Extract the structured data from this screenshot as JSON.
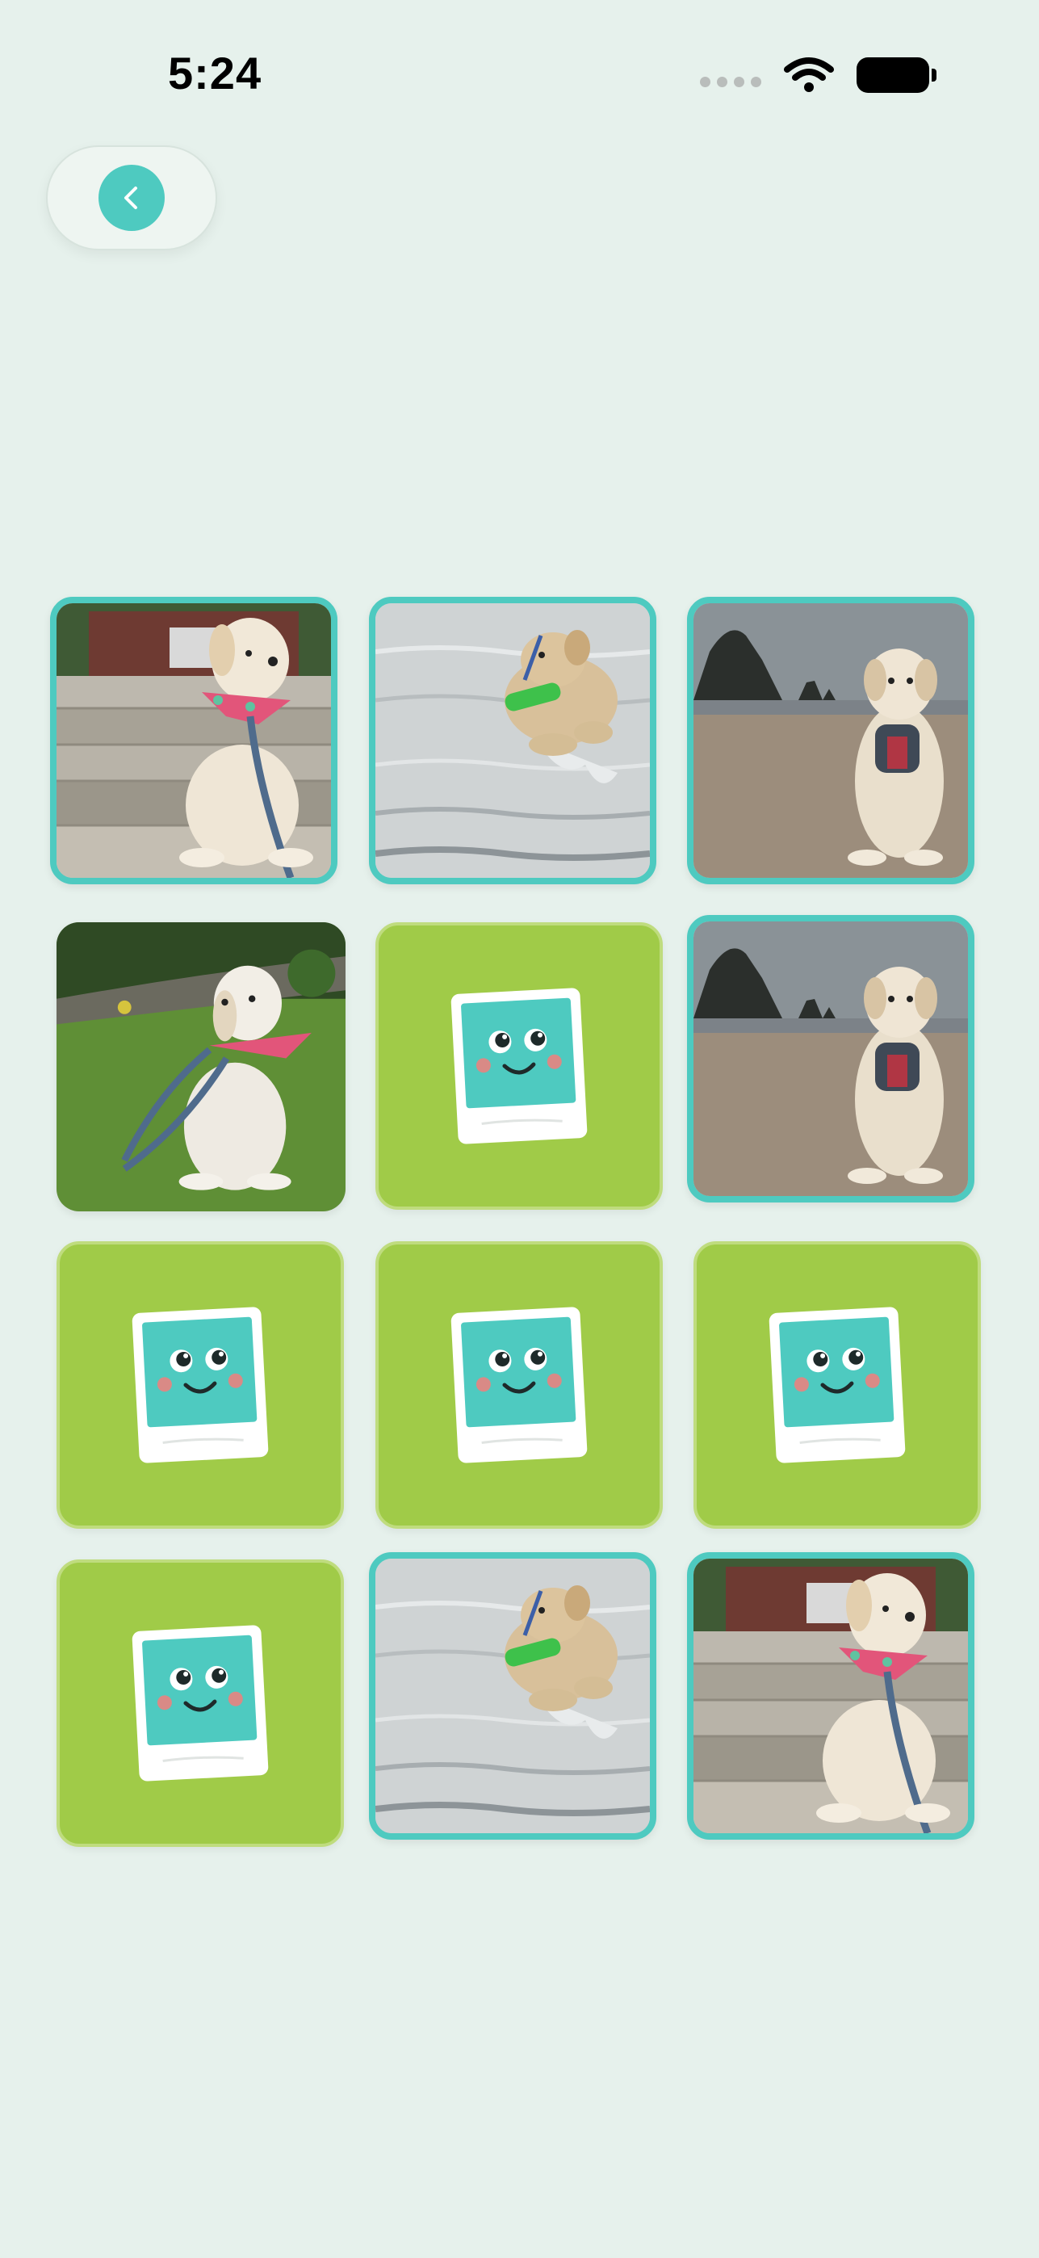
{
  "status_bar": {
    "time": "5:24",
    "signal_icon": "cellular-signal-icon",
    "wifi_icon": "wifi-icon",
    "battery_icon": "battery-full-icon"
  },
  "nav": {
    "back_icon": "chevron-left-icon"
  },
  "colors": {
    "background": "#e6f1ec",
    "accent_teal": "#4ecac0",
    "card_green": "#a0cb48",
    "mascot_cheeks": "#d98a86"
  },
  "board": {
    "rows": 4,
    "columns": 3,
    "cards": [
      {
        "state": "face-up",
        "matched_border": true,
        "image": "puppy-on-steps"
      },
      {
        "state": "face-up",
        "matched_border": true,
        "image": "dog-running-in-water"
      },
      {
        "state": "face-up",
        "matched_border": true,
        "image": "dog-on-beach-with-haystack-rock"
      },
      {
        "state": "face-up",
        "matched_border": false,
        "image": "puppy-on-grass"
      },
      {
        "state": "face-down",
        "icon": "smiling-photo-mascot-icon"
      },
      {
        "state": "face-up",
        "matched_border": true,
        "image": "dog-on-beach-with-haystack-rock"
      },
      {
        "state": "face-down",
        "icon": "smiling-photo-mascot-icon"
      },
      {
        "state": "face-down",
        "icon": "smiling-photo-mascot-icon"
      },
      {
        "state": "face-down",
        "icon": "smiling-photo-mascot-icon"
      },
      {
        "state": "face-down",
        "icon": "smiling-photo-mascot-icon"
      },
      {
        "state": "face-up",
        "matched_border": true,
        "image": "dog-running-in-water"
      },
      {
        "state": "face-up",
        "matched_border": true,
        "image": "puppy-on-steps"
      }
    ]
  }
}
